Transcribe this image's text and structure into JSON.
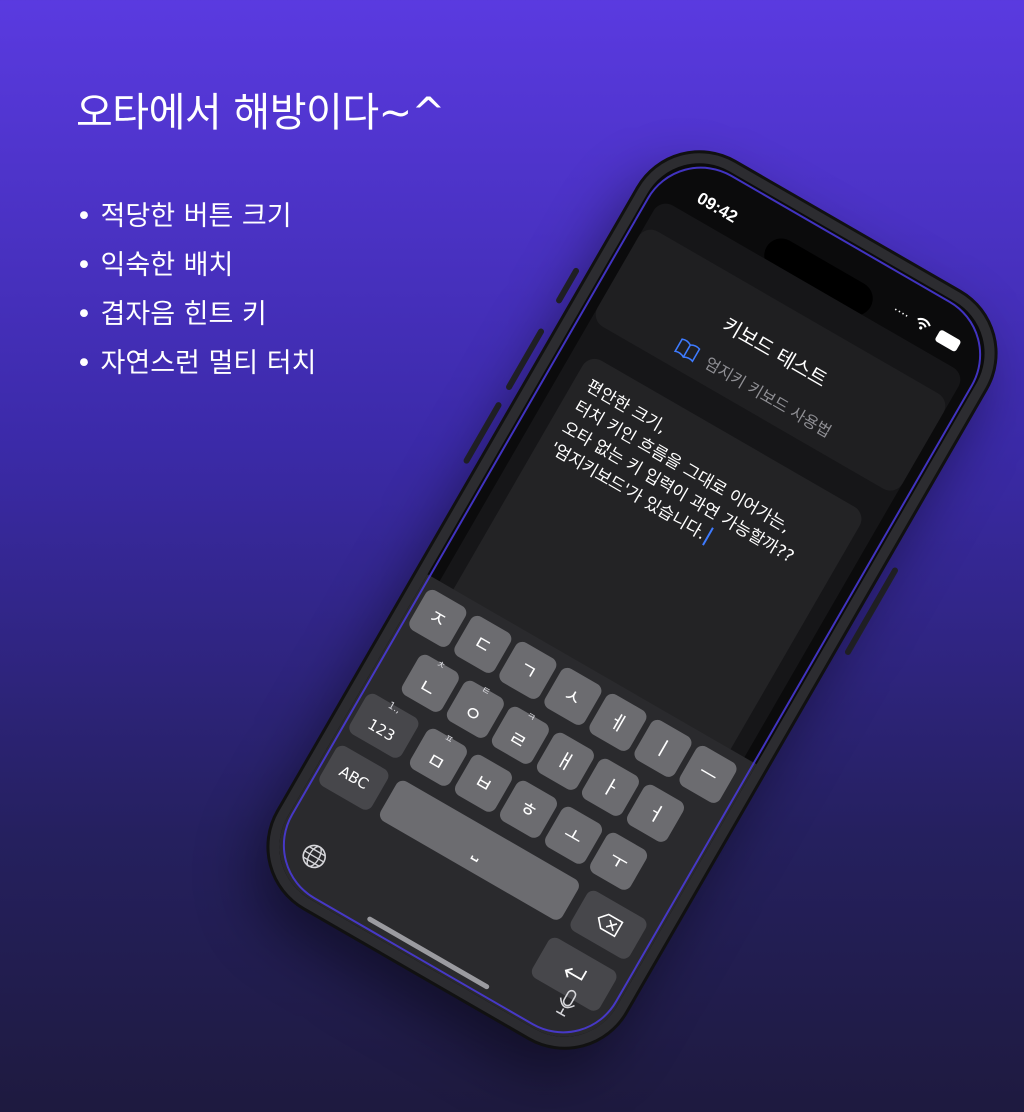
{
  "promo": {
    "headline": "오타에서 해방이다~^",
    "features": [
      "적당한 버튼 크기",
      "익숙한 배치",
      "겹자음 힌트 키",
      "자연스런 멀티 터치"
    ]
  },
  "status_bar": {
    "time": "09:42",
    "signal": "····"
  },
  "app": {
    "title": "키보드 테스트",
    "guide_link": "엄지키 키보드 사용법",
    "editor_lines": [
      "편안한 크기,",
      "터치 키인 흐름을 그대로 이어가는,",
      "오타 없는 키 입력이 과연 가능할까??",
      "'엄지키보드'가 있습니다."
    ]
  },
  "keyboard": {
    "row1": [
      {
        "key": "ㅈ"
      },
      {
        "key": "ㄷ"
      },
      {
        "key": "ㄱ"
      },
      {
        "key": "ㅅ"
      },
      {
        "key": "ㅔ"
      },
      {
        "key": "ㅣ"
      },
      {
        "key": "ㅡ"
      }
    ],
    "row2": [
      {
        "key": "ㄴ",
        "hint": "ㅊ"
      },
      {
        "key": "ㅇ",
        "hint": "ㅌ"
      },
      {
        "key": "ㄹ",
        "hint": "ㅋ"
      },
      {
        "key": "ㅐ"
      },
      {
        "key": "ㅏ"
      },
      {
        "key": "ㅓ"
      }
    ],
    "row3": [
      {
        "key": "ㅁ",
        "hint": "ㅍ"
      },
      {
        "key": "ㅂ"
      },
      {
        "key": "ㅎ"
      },
      {
        "key": "ㅗ"
      },
      {
        "key": "ㅜ"
      }
    ],
    "numbers_key": "123",
    "numbers_hint": "1.,",
    "abc_key": "ABC",
    "space_key": "⎵",
    "backspace_icon": "backspace-icon",
    "return_icon": "return-icon",
    "globe_icon": "globe-icon",
    "mic_icon": "microphone-icon"
  },
  "colors": {
    "accent": "#3e7bff",
    "background_top": "#5a3ae0",
    "background_bottom": "#1e1a3f"
  }
}
